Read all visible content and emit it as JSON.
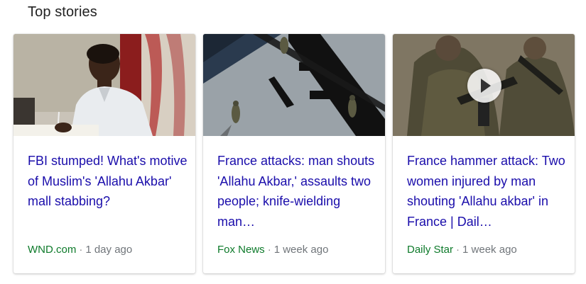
{
  "section": {
    "title": "Top stories"
  },
  "stories": [
    {
      "headline": "FBI stumped! What's motive of Muslim's 'Allahu Akbar' mall stabbing?",
      "source": "WND.com",
      "separator": "·",
      "time": "1 day ago",
      "thumb_icon": "photo-man-at-desk"
    },
    {
      "headline": "France attacks: man shouts 'Allahu Akbar,' assaults two people; knife-wielding man…",
      "source": "Fox News",
      "separator": "·",
      "time": "1 week ago",
      "thumb_icon": "photo-aerial-soldiers"
    },
    {
      "headline": "France hammer attack: Two women injured by man shouting 'Allahu akbar' in France | Dail…",
      "source": "Daily Star",
      "separator": "·",
      "time": "1 week ago",
      "thumb_icon": "photo-soldiers-video",
      "has_video": true
    }
  ],
  "colors": {
    "headline": "#1a0dab",
    "source": "#0d7a2a",
    "meta": "#70757a"
  }
}
